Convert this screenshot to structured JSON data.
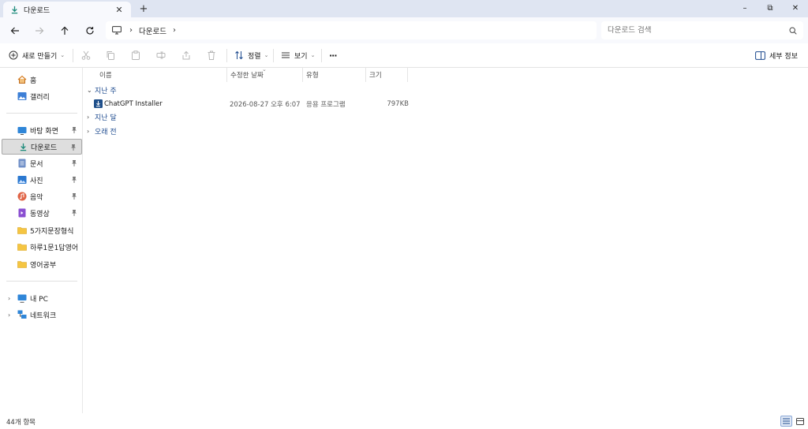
{
  "tab": {
    "title": "다운로드"
  },
  "window": {
    "minimize": "–",
    "maximize": "⧉",
    "close": "✕"
  },
  "address": {
    "crumbs": [
      "다운로드"
    ]
  },
  "search": {
    "placeholder": "다운로드 검색"
  },
  "toolbar": {
    "new_label": "새로 만들기",
    "sort_label": "정렬",
    "view_label": "보기",
    "more_label": "···",
    "details_label": "세부 정보"
  },
  "sidebar": {
    "items": [
      {
        "label": "홈",
        "icon": "home-icon"
      },
      {
        "label": "갤러리",
        "icon": "gallery-icon"
      },
      {
        "label": "바탕 화면",
        "icon": "desktop-icon",
        "pinned": true
      },
      {
        "label": "다운로드",
        "icon": "download-icon",
        "pinned": true,
        "selected": true
      },
      {
        "label": "문서",
        "icon": "document-icon",
        "pinned": true
      },
      {
        "label": "사진",
        "icon": "pictures-icon",
        "pinned": true
      },
      {
        "label": "음악",
        "icon": "music-icon",
        "pinned": true
      },
      {
        "label": "동영상",
        "icon": "video-icon",
        "pinned": true
      },
      {
        "label": "5가지문장형식",
        "icon": "folder-icon"
      },
      {
        "label": "하루1문1답영어",
        "icon": "folder-icon"
      },
      {
        "label": "영어공부",
        "icon": "folder-icon"
      },
      {
        "label": "내 PC",
        "icon": "pc-icon"
      },
      {
        "label": "네트워크",
        "icon": "network-icon"
      }
    ]
  },
  "columns": {
    "name": "이름",
    "modified": "수정한 날짜",
    "type": "유형",
    "size": "크기"
  },
  "groups": [
    {
      "label": "지난 주",
      "expanded": true,
      "files": [
        {
          "name": "ChatGPT Installer",
          "modified": "2026-08-27 오후 6:07",
          "type": "응용 프로그램",
          "size": "797KB"
        }
      ]
    },
    {
      "label": "지난 달",
      "expanded": false
    },
    {
      "label": "오래 전",
      "expanded": false
    }
  ],
  "status": {
    "count": "44개 항목"
  },
  "colors": {
    "accent": "#1e4b8f",
    "tabbar": "#dfe5f2",
    "selected": "#dedede"
  }
}
